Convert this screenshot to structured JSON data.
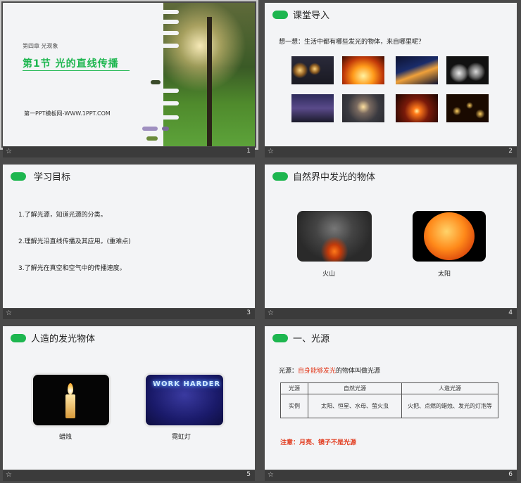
{
  "slides": [
    {
      "number": "1",
      "chapter": "第四章 光现象",
      "title": "第1节  光的直线传播",
      "site": "第一PPT模板网-WWW.1PPT.COM"
    },
    {
      "number": "2",
      "title": "课堂导入",
      "question": "想一想：生活中都有哪些发光的物体，来自哪里呢？",
      "images": [
        "string-lights",
        "fire",
        "city-light-trails",
        "smoke-spheres",
        "aurora-sky",
        "sparkler-person",
        "sunset",
        "candles"
      ]
    },
    {
      "number": "3",
      "title": "学习目标",
      "goals": [
        "1.了解光源，知道光源的分类。",
        "2.理解光沿直线传播及其应用。(重难点)",
        "3.了解光在真空和空气中的传播速度。"
      ]
    },
    {
      "number": "4",
      "title": "自然界中发光的物体",
      "items": [
        "火山",
        "太阳"
      ]
    },
    {
      "number": "5",
      "title": "人造的发光物体",
      "items": [
        "蜡烛",
        "霓虹灯"
      ],
      "neon_text": "WORK HARDER"
    },
    {
      "number": "6",
      "title": "一、光源",
      "definition_prefix": "光源：",
      "definition_highlight": "自身能够发光",
      "definition_suffix": "的物体叫做光源",
      "table": {
        "headers": [
          "光源",
          "自然光源",
          "人造光源"
        ],
        "row_label": "实例",
        "natural": "太阳、恒星、水母、萤火虫",
        "artificial": "火把、点燃的蜡烛、发光的灯泡等"
      },
      "note": "注意：月亮、镜子不是光源"
    }
  ],
  "colors": {
    "accent_green": "#1db64f",
    "note_red": "#e23a1d",
    "background": "#4a4a4a"
  }
}
